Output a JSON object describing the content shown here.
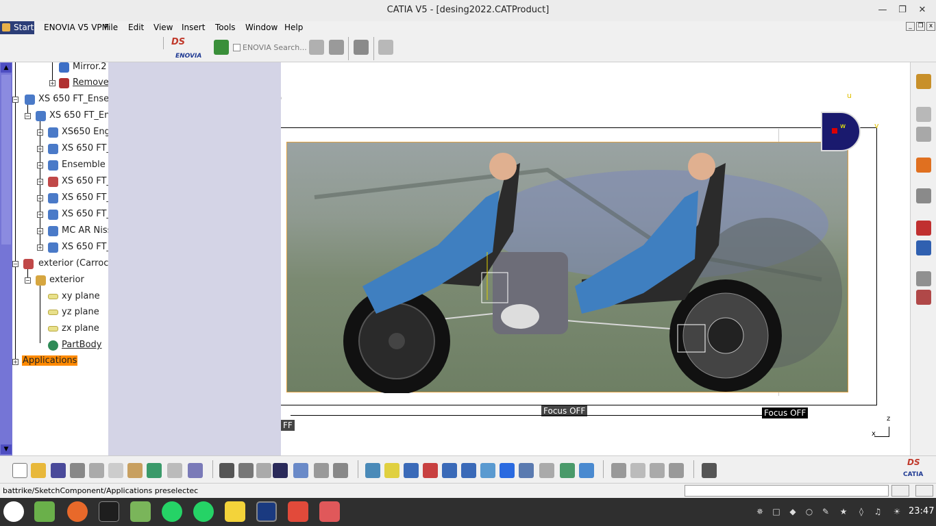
{
  "window": {
    "title": "CATIA V5 - [desing2022.CATProduct]"
  },
  "menu": {
    "start": "Start",
    "items": [
      "ENOVIA V5 VPM",
      "File",
      "Edit",
      "View",
      "Insert",
      "Tools",
      "Window",
      "Help"
    ]
  },
  "top_toolbar": {
    "enovia_search": "ENOVIA Search...",
    "enovia_logo": "ENOVIA"
  },
  "tree": {
    "nodes": [
      "Mirror.2",
      "Remove",
      "XS 650 FT_Ense",
      "XS 650 FT_En",
      "XS650 Eng",
      "XS 650 FT_",
      "Ensemble b",
      "XS 650 FT_",
      "XS 650 FT_",
      "XS 650 FT_",
      "MC AR Niss",
      "XS 650 FT_",
      "exterior (Carroce",
      "exterior",
      "xy plane",
      "yz plane",
      "zx plane",
      "PartBody",
      "Applications"
    ]
  },
  "viewport": {
    "focus_center": "Focus OFF",
    "focus_right": "Focus OFF",
    "focus_left_fragment": "FF",
    "paren_fragment": ")",
    "compass": {
      "u": "u",
      "v": "v",
      "w": "w"
    },
    "axis": {
      "x": "x",
      "z": "z"
    }
  },
  "statusbar": {
    "text": "battrike/SketchComponent/Applications preselectec"
  },
  "brand": {
    "catia": "CATIA"
  },
  "taskbar": {
    "clock": "23:47"
  },
  "colors": {
    "tree_scroll": "#7575d6",
    "selected_highlight": "#ff8a00",
    "taskbar_bg": "#2f2f2f",
    "compass": "#1a1a6e"
  },
  "icons": [
    "start-icon",
    "enovia-icon",
    "search-icon",
    "camera-icon",
    "zoom-in-icon",
    "zoom-out-icon"
  ]
}
